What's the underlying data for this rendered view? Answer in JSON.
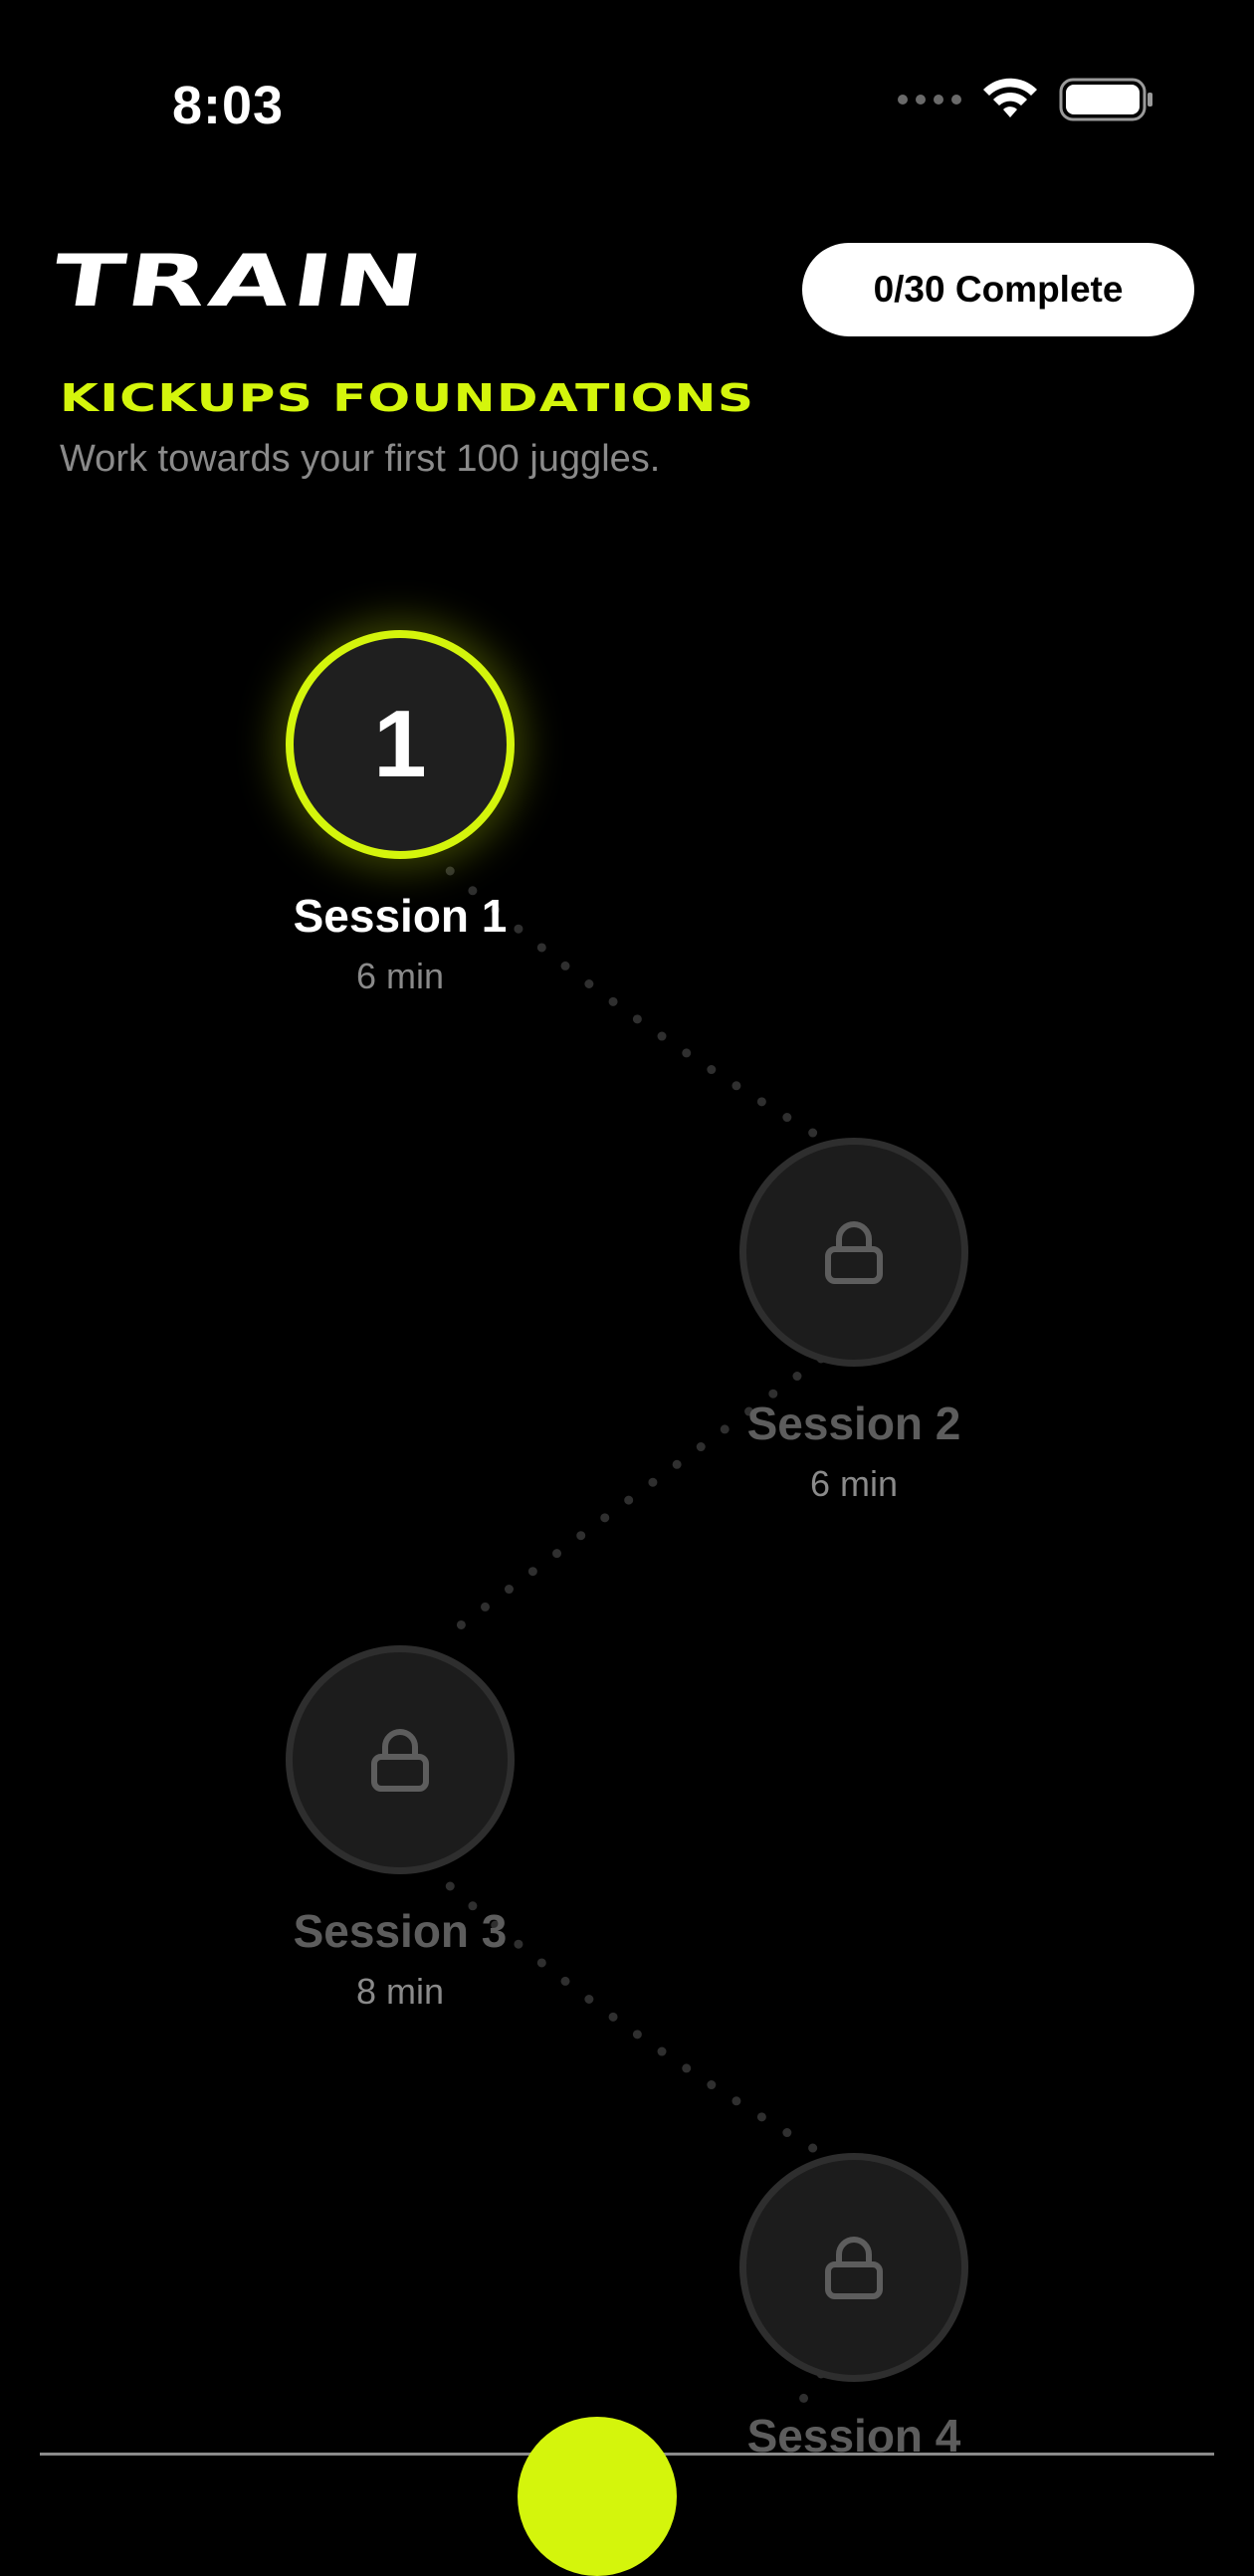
{
  "status_bar": {
    "time": "8:03"
  },
  "header": {
    "title": "TRAIN",
    "progress_label": "0/30 Complete"
  },
  "program": {
    "name": "KICKUPS FOUNDATIONS",
    "description": "Work towards your first 100 juggles."
  },
  "sessions": [
    {
      "number": "1",
      "label": "Session 1",
      "duration": "6 min",
      "state": "active"
    },
    {
      "number": "2",
      "label": "Session 2",
      "duration": "6 min",
      "state": "locked"
    },
    {
      "number": "3",
      "label": "Session 3",
      "duration": "8 min",
      "state": "locked"
    },
    {
      "number": "4",
      "label": "Session 4",
      "duration": "",
      "state": "locked"
    }
  ],
  "icons": {
    "locked_node": "lock-icon",
    "wifi": "wifi-icon",
    "battery": "battery-icon",
    "cellular": "cellular-signal-icon"
  },
  "colors": {
    "accent": "#d4f50c",
    "background": "#000000",
    "locked_node_fill": "#1c1c1c",
    "muted_text": "#8a8a8a"
  }
}
